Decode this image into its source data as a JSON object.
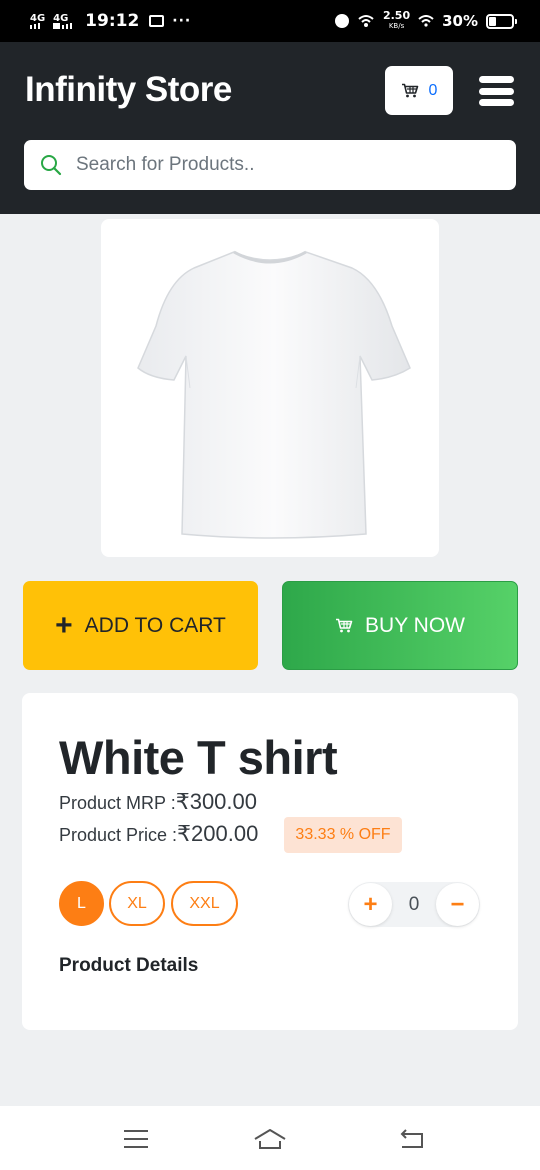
{
  "status_bar": {
    "network_1": "4G",
    "network_2": "4G",
    "time": "19:12",
    "more": "···",
    "speed_value": "2.50",
    "speed_unit": "KB/s",
    "battery": "30%"
  },
  "header": {
    "brand": "Infinity Store",
    "cart_count": "0"
  },
  "search": {
    "placeholder": "Search for Products.."
  },
  "actions": {
    "add_to_cart_icon": "+",
    "add_to_cart": "ADD TO CART",
    "buy_now": "BUY NOW"
  },
  "product": {
    "title": "White T shirt",
    "mrp_label": "Product MRP :",
    "mrp_value": "₹300.00",
    "price_label": "Product Price :",
    "price_value": "₹200.00",
    "discount": "33.33 % OFF",
    "sizes": [
      "L",
      "XL",
      "XXL"
    ],
    "selected_size": "L",
    "quantity": "0",
    "qty_plus": "+",
    "qty_minus": "−",
    "details_heading": "Product Details"
  },
  "colors": {
    "header_bg": "#212529",
    "add_to_cart_bg": "#ffc107",
    "buy_now_bg": "#2ea84a",
    "accent_orange": "#fd7e14",
    "cart_count_blue": "#0d6efd"
  },
  "icons": {
    "search": "search-icon",
    "cart": "cart-icon",
    "menu": "hamburger-menu-icon",
    "nav_menu": "recent-apps-icon",
    "nav_home": "home-icon",
    "nav_back": "back-icon"
  }
}
